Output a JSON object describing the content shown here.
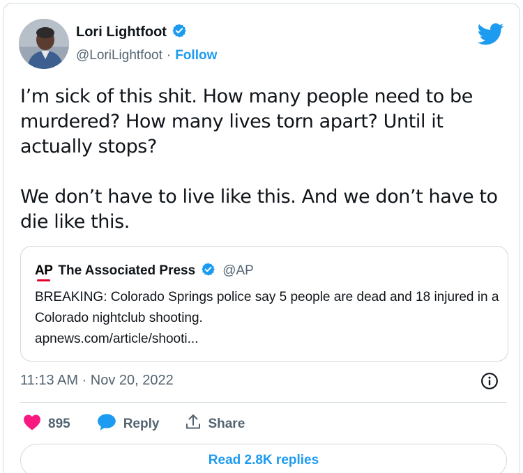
{
  "author": {
    "name": "Lori Lightfoot",
    "handle": "@LoriLightfoot",
    "separator": "·",
    "follow_label": "Follow"
  },
  "tweet": {
    "paragraphs": [
      "I’m sick of this shit. How many people need to be murdered? How many lives torn apart? Until it actually stops?",
      "We don’t have to live like this. And we don’t have to die like this."
    ]
  },
  "quote": {
    "logo_text": "AP",
    "name": "The Associated Press",
    "handle": "@AP",
    "text": "BREAKING: Colorado Springs police say 5 people are dead and 18 injured in a Colorado nightclub shooting.",
    "link": "apnews.com/article/shooti..."
  },
  "meta": {
    "timestamp": "11:13 AM · Nov 20, 2022"
  },
  "actions": {
    "likes": "895",
    "reply_label": "Reply",
    "share_label": "Share"
  },
  "read_replies_label": "Read 2.8K replies",
  "colors": {
    "accent": "#1d9bf0",
    "heart": "#f91880",
    "text": "#0f1419",
    "muted": "#536471",
    "border": "#cfd9de"
  },
  "icons": {
    "bird": "twitter-bird-icon",
    "verified": "verified-badge-icon",
    "info": "info-icon",
    "heart": "heart-icon",
    "reply": "reply-bubble-icon",
    "share": "share-icon"
  }
}
